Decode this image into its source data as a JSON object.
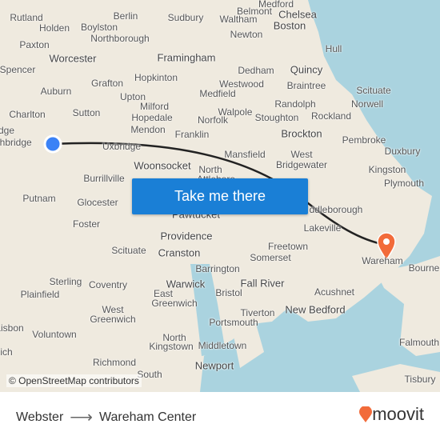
{
  "map": {
    "places": [
      "Rutland",
      "Holden",
      "Boylston",
      "Berlin",
      "Sudbury",
      "Waltham",
      "Belmont",
      "Medford",
      "Chelsea",
      "Boston",
      "Paxton",
      "Northborough",
      "Newton",
      "Hull",
      "Spencer",
      "Worcester",
      "Framingham",
      "Quincy",
      "Dedham",
      "Auburn",
      "Grafton",
      "Hopkinton",
      "Westwood",
      "Braintree",
      "Scituate",
      "Medfield",
      "Upton",
      "Randolph",
      "Norwell",
      "Milford",
      "Walpole",
      "Charlton",
      "Sutton",
      "Hopedale",
      "Norfolk",
      "Stoughton",
      "Rockland",
      "Mendon",
      "Franklin",
      "Brockton",
      "Pembroke",
      "Duxbury",
      "dge",
      "thbridge",
      "Uxbridge",
      "Mansfield",
      "West",
      "Bridgewater",
      "Kingston",
      "Woonsocket",
      "North",
      "Attleboro",
      "Plymouth",
      "Burrillville",
      "Putnam",
      "Glocester",
      "ddleborough",
      "Pawtucket",
      "Lakeville",
      "Foster",
      "Providence",
      "Freetown",
      "Scituate",
      "Cranston",
      "Somerset",
      "Wareham",
      "Bourne",
      "Barrington",
      "Sterling",
      "Coventry",
      "Warwick",
      "Fall River",
      "Plainfield",
      "Bristol",
      "Acushnet",
      "East",
      "Greenwich",
      "West",
      "Greenwich",
      "Tiverton",
      "New Bedford",
      "Portsmouth",
      "Lisbon",
      "Voluntown",
      "North",
      "Kingstown",
      "Middletown",
      "Falmouth",
      "ich",
      "Richmond",
      "Newport",
      "South",
      "Tisbury"
    ],
    "attribution": "© OpenStreetMap contributors",
    "cta_label": "Take me there",
    "origin_marker_color": "#3b82f6",
    "destination_marker_color": "#f26b3a",
    "water_color": "#aad3df"
  },
  "footer": {
    "origin": "Webster",
    "destination": "Wareham Center",
    "brand": "moovit",
    "brand_color": "#f26b3a"
  }
}
